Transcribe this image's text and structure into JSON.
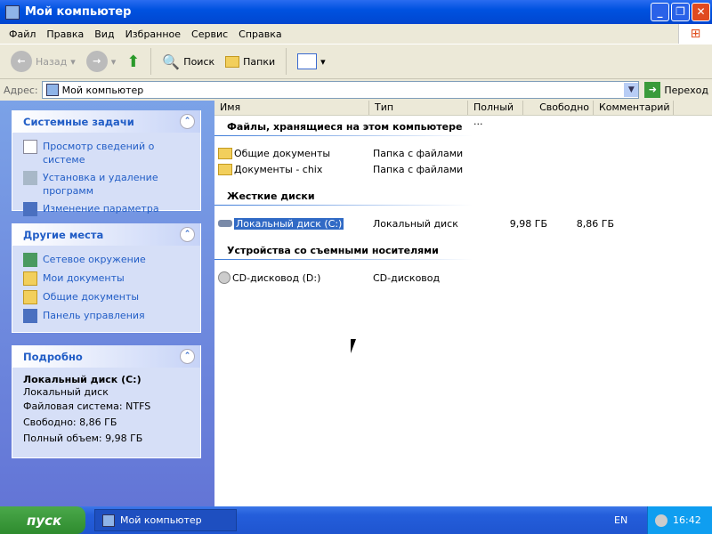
{
  "window": {
    "title": "Мой компьютер"
  },
  "menu": [
    "Файл",
    "Правка",
    "Вид",
    "Избранное",
    "Сервис",
    "Справка"
  ],
  "toolbar": {
    "back": "Назад",
    "search": "Поиск",
    "folders": "Папки"
  },
  "address": {
    "label": "Адрес:",
    "value": "Мой компьютер",
    "go": "Переход"
  },
  "left": {
    "system_tasks": {
      "title": "Системные задачи",
      "items": [
        "Просмотр сведений о системе",
        "Установка и удаление программ",
        "Изменение параметра"
      ]
    },
    "other_places": {
      "title": "Другие места",
      "items": [
        "Сетевое окружение",
        "Мои документы",
        "Общие документы",
        "Панель управления"
      ]
    },
    "details": {
      "title": "Подробно",
      "name": "Локальный диск (C:)",
      "type": "Локальный диск",
      "fs": "Файловая система: NTFS",
      "free": "Свободно: 8,86 ГБ",
      "total": "Полный объем: 9,98 ГБ"
    }
  },
  "columns": [
    "Имя",
    "Тип",
    "Полный ...",
    "Свободно",
    "Комментарий"
  ],
  "groups": [
    {
      "title": "Файлы, хранящиеся на этом компьютере",
      "items": [
        {
          "name": "Общие документы",
          "type": "Папка с файлами"
        },
        {
          "name": "Документы - chix",
          "type": "Папка с файлами"
        }
      ]
    },
    {
      "title": "Жесткие диски",
      "items": [
        {
          "name": "Локальный диск (C:)",
          "type": "Локальный диск",
          "size": "9,98 ГБ",
          "free": "8,86 ГБ"
        }
      ]
    },
    {
      "title": "Устройства со съемными носителями",
      "items": [
        {
          "name": "CD-дисковод (D:)",
          "type": "CD-дисковод"
        }
      ]
    }
  ],
  "taskbar": {
    "start": "пуск",
    "task": "Мой компьютер",
    "lang": "EN",
    "clock": "16:42"
  }
}
